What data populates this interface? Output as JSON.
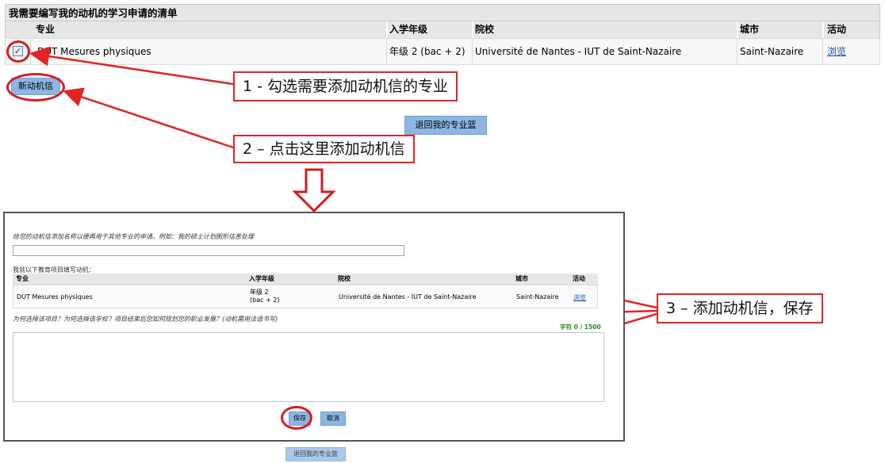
{
  "top_table": {
    "title": "我需要编写我的动机的学习申请的清单",
    "headers": {
      "major": "专业",
      "year": "入学年级",
      "school": "院校",
      "city": "城市",
      "action": "活动"
    },
    "row": {
      "major": "DUT Mesures physiques",
      "year": "年级 2 (bac + 2)",
      "school": "Université de Nantes - IUT de Saint-Nazaire",
      "city": "Saint-Nazaire",
      "action": "浏览"
    }
  },
  "buttons": {
    "new_letter": "新动机信",
    "back_to_basket": "退回我的专业篮"
  },
  "callouts": {
    "step1": "1 - 勾选需要添加动机信的专业",
    "step2": "2 – 点击这里添加动机信",
    "step3": "3 – 添加动机信，保存"
  },
  "panel": {
    "name_prompt": "给您的动机信添加名称以便再用于其他专业的申请。例如：我的硕士计划图形信息处理",
    "name_value": "",
    "fill_for": "我就以下教育项目填写动机：",
    "headers": {
      "major": "专业",
      "year": "入学年级",
      "school": "院校",
      "city": "城市",
      "action": "活动"
    },
    "row": {
      "major": "DUT Mesures physiques",
      "year_line1": "年级 2",
      "year_line2": "(bac + 2)",
      "school": "Université de Nantes - IUT de Saint-Nazaire",
      "city": "Saint-Nazaire",
      "action": "浏览"
    },
    "question": "为何选择该项目？为何选择该学校？项目结束后您如何规划您的职业发展？(动机需用法语书写)",
    "counter": "字符 0 / 1500",
    "motivation_value": "",
    "save": "保存",
    "cancel": "取消",
    "back": "退回我的专业篮"
  },
  "colors": {
    "annotation_red": "#e02424",
    "button_blue": "#8db6e3",
    "header_gray": "#e6e6e6"
  }
}
